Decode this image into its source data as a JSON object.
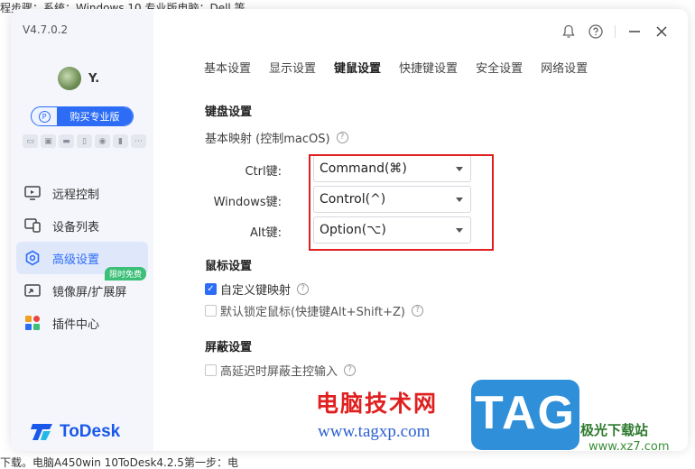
{
  "background": {
    "line1": "程步骤：系统：Windows 10 专业版电脑：Dell 等",
    "line1_red": "电脑",
    "line2": "下载。电脑A450win 10ToDesk4.2.5第一步：电",
    "line2_red": "电脑"
  },
  "app": {
    "version": "V4.7.0.2",
    "username": "Y.",
    "buy_pro": "购买专业版",
    "logo_text": "ToDesk"
  },
  "sidebar": {
    "items": [
      {
        "label": "远程控制"
      },
      {
        "label": "设备列表"
      },
      {
        "label": "高级设置"
      },
      {
        "label": "镜像屏/扩展屏",
        "badge": "限时免费"
      },
      {
        "label": "插件中心"
      }
    ]
  },
  "topbar": {
    "bell": "bell-icon",
    "help": "question-icon",
    "minimize": "minimize-icon",
    "close": "close-icon"
  },
  "tabs": [
    "基本设置",
    "显示设置",
    "键鼠设置",
    "快捷键设置",
    "安全设置",
    "网络设置"
  ],
  "keyboard": {
    "title": "键盘设置",
    "mapping_label": "基本映射 (控制macOS)",
    "rows": [
      {
        "label": "Ctrl键:",
        "value": "Command(⌘)"
      },
      {
        "label": "Windows键:",
        "value": "Control(^)"
      },
      {
        "label": "Alt键:",
        "value": "Option(⌥)"
      }
    ]
  },
  "mouse": {
    "title": "鼠标设置",
    "custom_key": "自定义键映射",
    "custom_key_checked": true,
    "lock_mouse": "默认锁定鼠标(快捷键Alt+Shift+Z)",
    "lock_mouse_checked": false
  },
  "screen": {
    "title": "屏蔽设置",
    "delay_block": "高延迟时屏蔽主控输入",
    "delay_block_checked": false
  },
  "watermark": {
    "text": "电脑技术网",
    "url": "www.tagxp.com",
    "tag": "TAG",
    "site_name": "极光下载站",
    "site_url": "www.xz7.com"
  },
  "colors": {
    "accent": "#2d6df6",
    "highlight_box": "#e01e1e",
    "badge": "#3cbf77"
  }
}
